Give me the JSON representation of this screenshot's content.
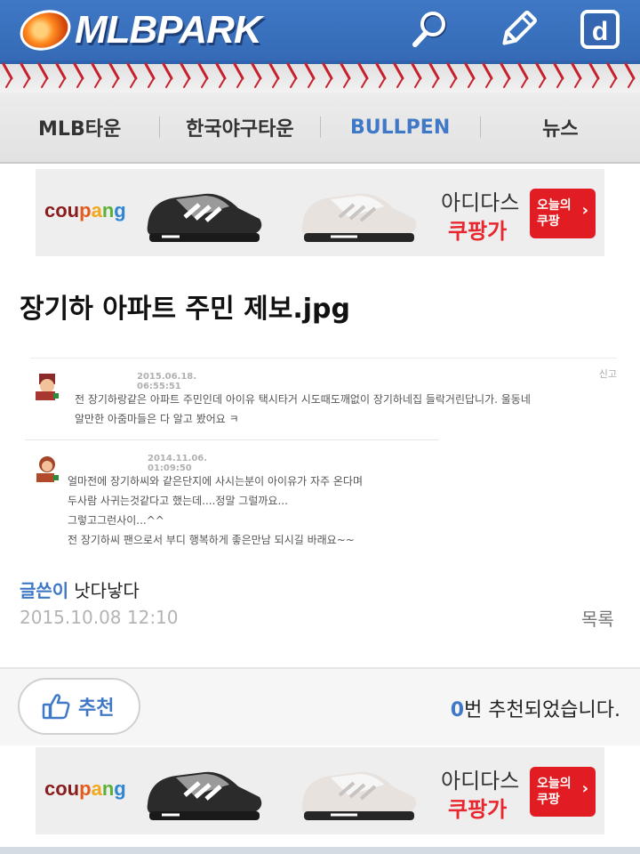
{
  "header": {
    "logo_text": "MLBPARK",
    "search_label": "search",
    "write_label": "write",
    "d_label": "d"
  },
  "nav": {
    "items": [
      {
        "label": "MLB타운"
      },
      {
        "label": "한국야구타운"
      },
      {
        "label": "BULLPEN"
      },
      {
        "label": "뉴스"
      }
    ]
  },
  "ad": {
    "brand": [
      "cou",
      "p",
      "a",
      "n",
      "g"
    ],
    "line1": "아디다스",
    "line2": "쿠팡가",
    "badge_line1": "오늘의",
    "badge_line2": "쿠팡",
    "badge_arrow": "›"
  },
  "post": {
    "title": "장기하 아파트 주민 제보.jpg",
    "report_label": "신고",
    "comments": [
      {
        "date": "2015.06.18. 06:55:51",
        "lines": [
          "전 장기하랑같은 아파트 주민인데 아이유 택시타거 시도때도깨없이 장기하네집 들락거린답니가. 울동네",
          "알만한 아줌마들은 다 알고 봤어요 ㅋ"
        ]
      },
      {
        "date": "2014.11.06. 01:09:50",
        "lines": [
          "얼마전에 장기하씨와 같은단지에 사시는분이 아이유가 자주 온다며",
          "두사람 사귀는것같다고 했는데....정말 그럴까요...",
          "그렇고그런사이...^^",
          "전 장기하씨 팬으로서 부디 행복하게 좋은만남 되시길 바래요~~"
        ]
      }
    ],
    "author_label": "글쓴이",
    "author_name": "낫다낳다",
    "date": "2015.10.08 12:10",
    "list_label": "목록"
  },
  "recommend": {
    "button_label": "추천",
    "count": "0",
    "count_suffix": "번 추천되었습니다."
  }
}
